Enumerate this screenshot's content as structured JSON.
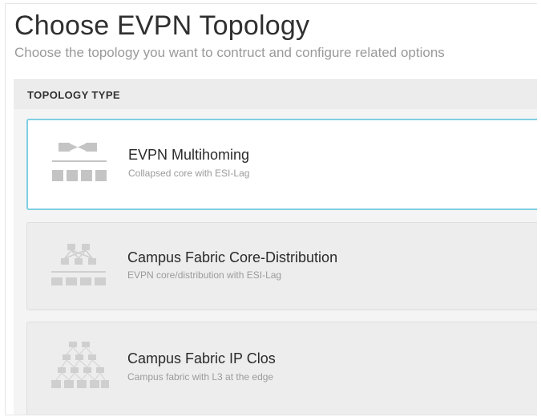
{
  "header": {
    "title": "Choose EVPN Topology",
    "subtitle": "Choose the topology you want to contruct and configure related options"
  },
  "section": {
    "label": "TOPOLOGY TYPE"
  },
  "topologies": [
    {
      "title": "EVPN Multihoming",
      "description": "Collapsed core with ESI-Lag",
      "icon": "evpn-multihoming-icon",
      "selected": true
    },
    {
      "title": "Campus Fabric Core-Distribution",
      "description": "EVPN core/distribution with ESI-Lag",
      "icon": "core-distribution-icon",
      "selected": false
    },
    {
      "title": "Campus Fabric IP Clos",
      "description": "Campus fabric with L3 at the edge",
      "icon": "ip-clos-icon",
      "selected": false
    }
  ],
  "colors": {
    "selected_border": "#7fcfe4",
    "icon_gray": "#c4c4c4"
  }
}
